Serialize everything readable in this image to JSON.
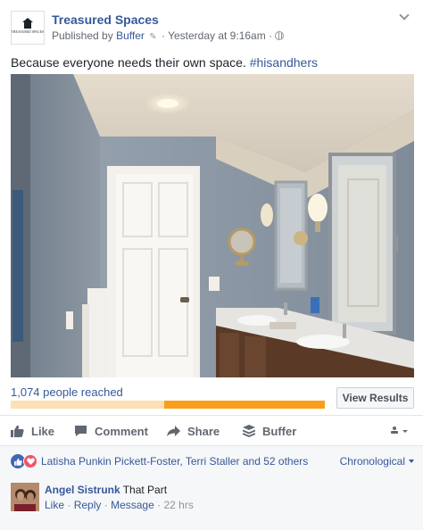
{
  "page": {
    "name": "Treasured Spaces",
    "logo_text": "TREASURED SPACES"
  },
  "post_meta": {
    "published_by_prefix": "Published by",
    "publisher": "Buffer",
    "separator": "·",
    "time": "Yesterday at 9:16am",
    "time_separator": "·"
  },
  "post": {
    "text": "Because everyone needs their own space.",
    "hashtag": "#hisandhers"
  },
  "stats": {
    "reach_label": "1,074 people reached",
    "reach_fraction": 0.51,
    "view_results_label": "View Results"
  },
  "actions": {
    "like": "Like",
    "comment": "Comment",
    "share": "Share",
    "buffer": "Buffer"
  },
  "reactions": {
    "names": "Latisha Punkin Pickett-Foster, Terri Staller and 52 others",
    "sort": "Chronological"
  },
  "comment": {
    "author": "Angel Sistrunk",
    "text": "That Part",
    "like": "Like",
    "reply": "Reply",
    "message": "Message",
    "sep": "·",
    "time": "22 hrs"
  },
  "colors": {
    "link": "#365899",
    "progress_fill": "#f99e1b",
    "progress_track": "#fde1b4",
    "like_reaction": "#4267b2",
    "love_reaction": "#f25268"
  },
  "icons": [
    "chevron-down-icon",
    "edit-icon",
    "globe-icon",
    "thumbs-up-icon",
    "comment-icon",
    "share-arrow-icon",
    "buffer-stack-icon",
    "audience-menu-icon",
    "like-reaction-icon",
    "love-reaction-icon"
  ]
}
